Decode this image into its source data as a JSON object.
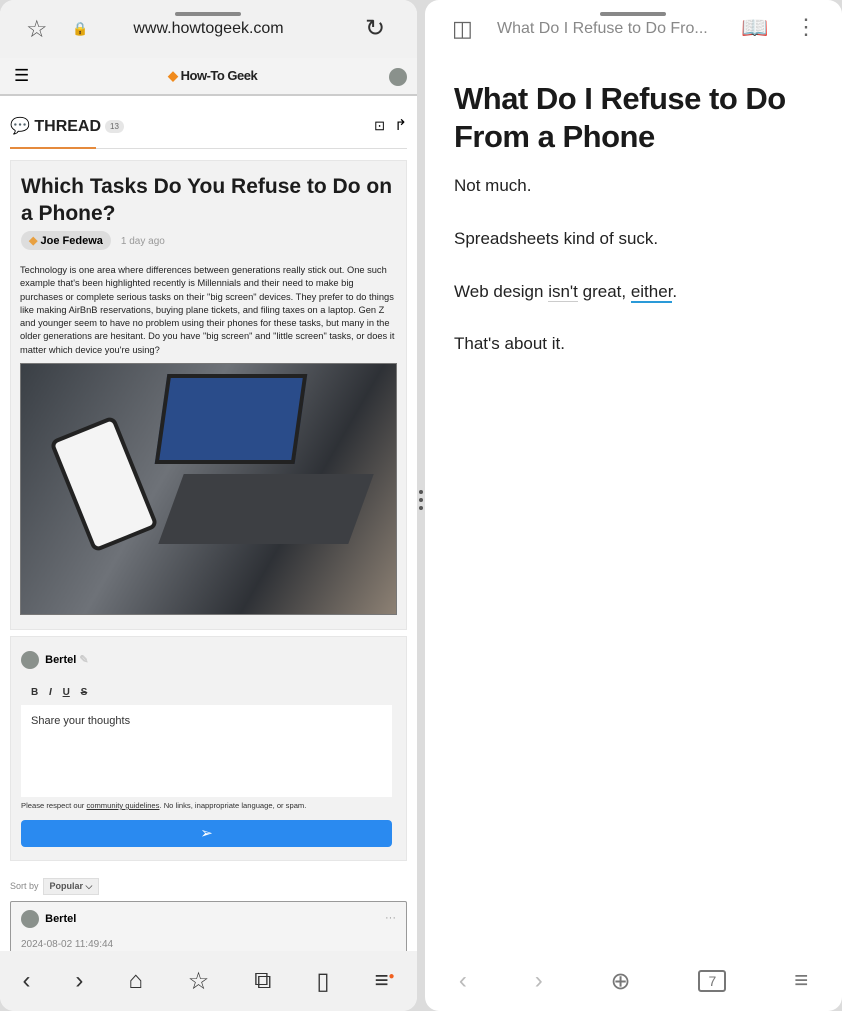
{
  "left": {
    "url": "www.howtogeek.com",
    "site": {
      "logo": "How-To Geek",
      "thread_label": "THREAD",
      "thread_count": "13",
      "post": {
        "title": "Which Tasks Do You Refuse to Do on a Phone?",
        "author": "Joe Fedewa",
        "time": "1 day ago",
        "body": "Technology is one area where differences between generations really stick out. One such example that's been highlighted recently is Millennials and their need to make big purchases or complete serious tasks on their \"big screen\" devices. They prefer to do things like making AirBnB reservations, buying plane tickets, and filing taxes on a laptop. Gen Z and younger seem to have no problem using their phones for these tasks, but many in the older generations are hesitant. Do you have \"big screen\" and \"little screen\" tasks, or does it matter which device you're using?"
      },
      "composer": {
        "user": "Bertel",
        "format": [
          "B",
          "I",
          "U",
          "S"
        ],
        "placeholder": "Share your thoughts",
        "rules_pre": "Please respect our ",
        "rules_link": "community guidelines",
        "rules_post": ". No links, inappropriate language, or spam."
      },
      "sort_label": "Sort by",
      "sort_value": "Popular",
      "comment": {
        "user": "Bertel",
        "time": "2024-08-02 11:49:44"
      }
    },
    "accent": "#2a8af0"
  },
  "right": {
    "tab_title": "What Do I Refuse to Do Fro...",
    "title": "What Do I Refuse to Do From a Phone",
    "paragraphs": [
      "Not much.",
      "Spreadsheets kind of suck."
    ],
    "p3_pre": "Web design ",
    "p3_u1": "isn't",
    "p3_mid": " great, ",
    "p3_u2": "either",
    "p3_end": ".",
    "p4": "That's about it.",
    "tab_count": "7"
  }
}
